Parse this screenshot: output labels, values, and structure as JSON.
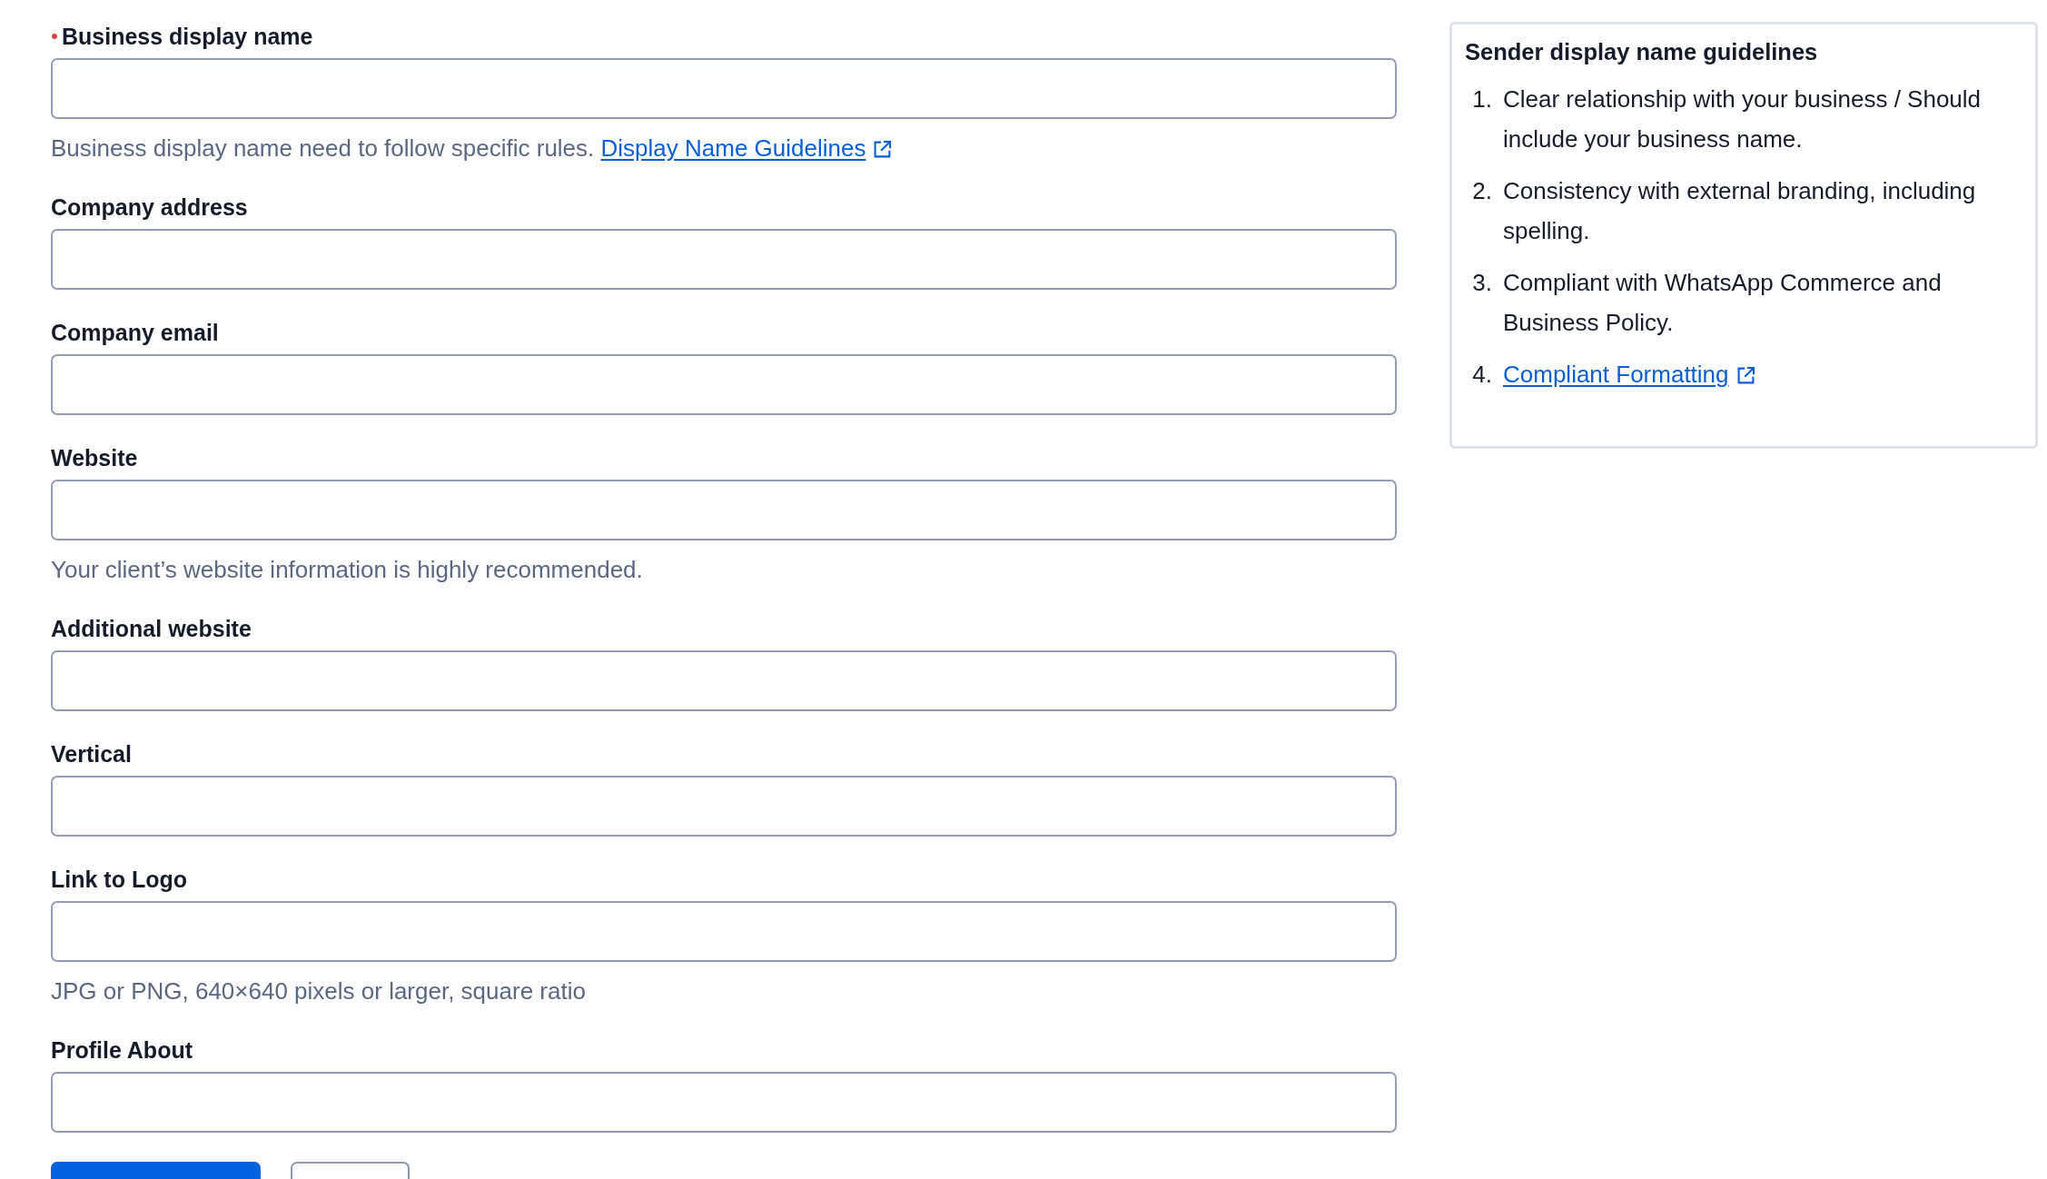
{
  "fields": [
    {
      "label": "Business display name",
      "required": true,
      "helper": {
        "text": "Business display name need to follow specific rules.",
        "link": "Display Name Guidelines"
      }
    },
    {
      "label": "Company address",
      "required": false
    },
    {
      "label": "Company email",
      "required": false
    },
    {
      "label": "Website",
      "required": false,
      "helper": {
        "text": "Your client’s website information is highly recommended."
      }
    },
    {
      "label": "Additional website",
      "required": false
    },
    {
      "label": "Vertical",
      "required": false
    },
    {
      "label": "Link to Logo",
      "required": false,
      "helper": {
        "text": "JPG or PNG, 640×640 pixels or larger, square ratio"
      }
    },
    {
      "label": "Profile About",
      "required": false
    }
  ],
  "buttons": [
    {
      "kind": "primary"
    },
    {
      "kind": "secondary"
    }
  ],
  "guidelines": {
    "title": "Sender display name guidelines",
    "items": [
      {
        "kind": "text",
        "number": "1.",
        "text": "Clear relationship with your business / Should include your business name."
      },
      {
        "kind": "text",
        "number": "2.",
        "text": "Consistency with external branding, including spelling."
      },
      {
        "kind": "text",
        "number": "3.",
        "text": "Compliant with WhatsApp Commerce and Business Policy."
      },
      {
        "kind": "link",
        "number": "4.",
        "text": "Compliant Formatting"
      }
    ]
  }
}
